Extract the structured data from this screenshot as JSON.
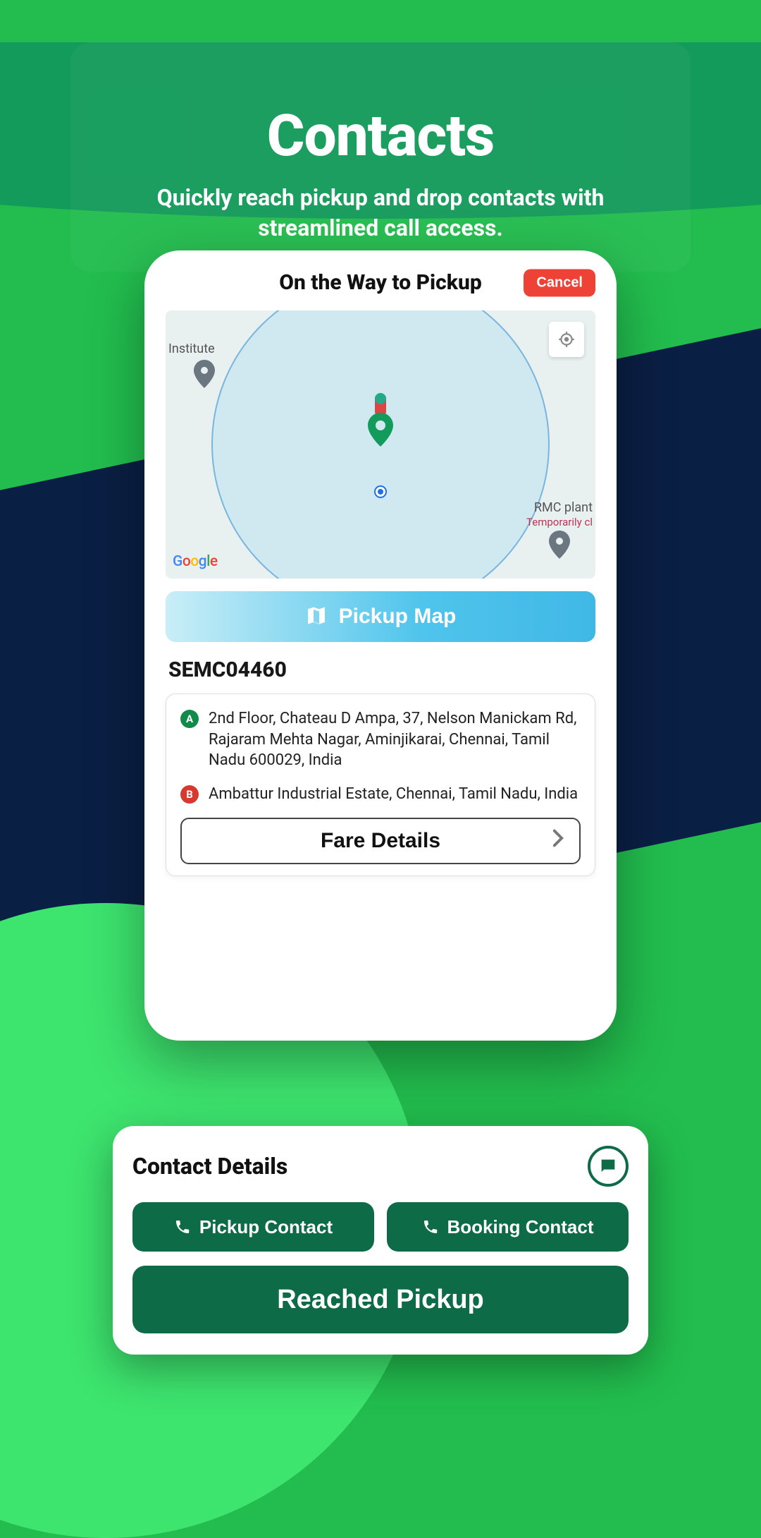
{
  "hero": {
    "title": "Contacts",
    "subtitle": "Quickly reach pickup and drop contacts with streamlined call access."
  },
  "header": {
    "title": "On the Way to Pickup",
    "cancel": "Cancel"
  },
  "map": {
    "institute_label": "Institute",
    "rmc_label": "RMC plant",
    "rmc_sub": "Temporarily cl",
    "google": "Google"
  },
  "pickup_map_label": "Pickup Map",
  "order_id": "SEMC04460",
  "addresses": {
    "a": "2nd Floor, Chateau D Ampa, 37, Nelson Manickam Rd, Rajaram Mehta Nagar, Aminjikarai, Chennai, Tamil Nadu 600029, India",
    "b": "Ambattur Industrial Estate, Chennai, Tamil Nadu, India"
  },
  "fare_label": "Fare Details",
  "contact": {
    "title": "Contact Details",
    "pickup": "Pickup Contact",
    "booking": "Booking Contact",
    "reached": "Reached Pickup"
  },
  "markers": {
    "a": "A",
    "b": "B"
  }
}
